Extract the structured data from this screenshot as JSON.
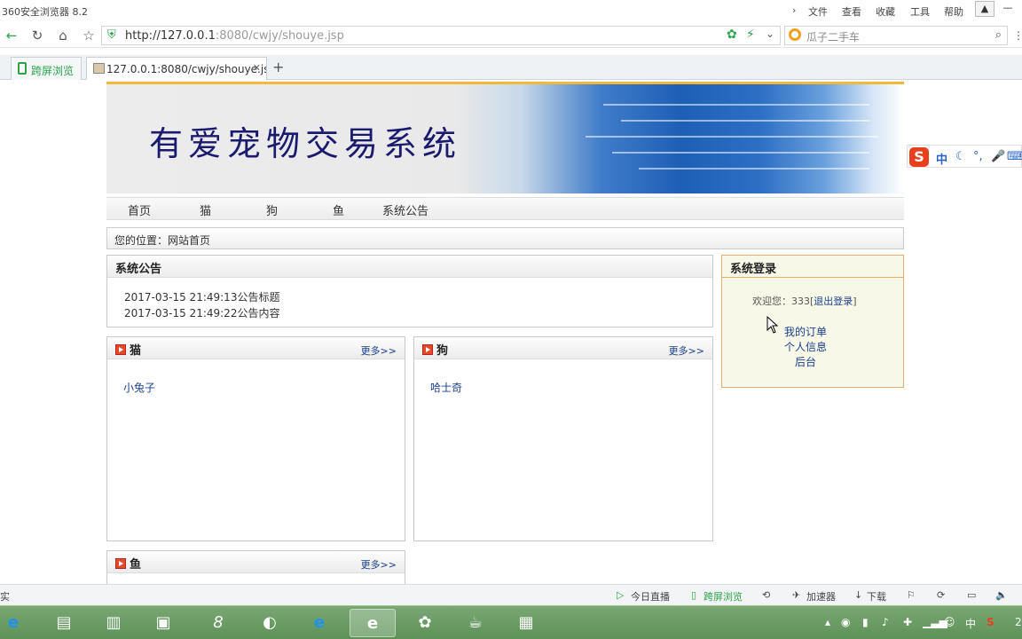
{
  "browser": {
    "title": "360安全浏览器 8.2",
    "menu": [
      "文件",
      "查看",
      "收藏",
      "工具",
      "帮助"
    ],
    "url_host": "http://127.0.0.1",
    "url_rest": ":8080/cwjy/shouye.jsp",
    "search_text": "瓜子二手车",
    "tabs": [
      {
        "label": "跨屏浏览"
      },
      {
        "label": "127.0.0.1:8080/cwjy/shouye.js"
      }
    ],
    "new_tab": "+"
  },
  "site": {
    "title": "有爱宠物交易系统",
    "nav": [
      "首页",
      "猫",
      "狗",
      "鱼",
      "系统公告"
    ],
    "breadcrumb": "您的位置：网站首页",
    "notice_panel": {
      "title": "系统公告",
      "items": [
        "2017-03-15 21:49:13公告标题",
        "2017-03-15 21:49:22公告内容"
      ]
    },
    "login_panel": {
      "title": "系统登录",
      "welcome_prefix": "欢迎您：333[",
      "logout": "退出登录",
      "welcome_suffix": "]",
      "links": [
        "我的订单",
        "个人信息",
        "后台"
      ]
    },
    "category_panels": [
      {
        "title": "猫",
        "more": "更多>>",
        "items": [
          "小兔子"
        ]
      },
      {
        "title": "狗",
        "more": "更多>>",
        "items": [
          "哈士奇"
        ]
      },
      {
        "title": "鱼",
        "more": "更多>>",
        "items": []
      }
    ]
  },
  "ime": {
    "mode": "中"
  },
  "statusbar": {
    "left": "实",
    "items": [
      "今日直播",
      "跨屏浏览",
      "加速器",
      "下载"
    ]
  },
  "tray": {
    "ime": "中",
    "clock": "2"
  }
}
